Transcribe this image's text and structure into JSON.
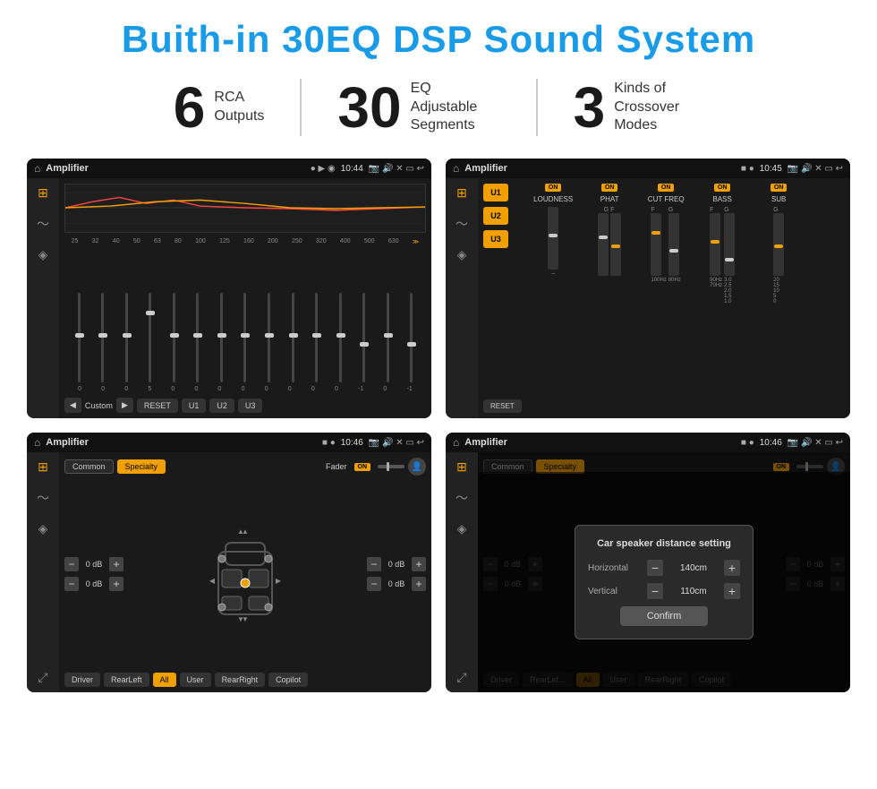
{
  "header": {
    "title": "Buith-in 30EQ DSP Sound System"
  },
  "stats": [
    {
      "number": "6",
      "label": "RCA\nOutputs"
    },
    {
      "number": "30",
      "label": "EQ Adjustable\nSegments"
    },
    {
      "number": "3",
      "label": "Kinds of\nCrossover Modes"
    }
  ],
  "screens": [
    {
      "id": "screen1",
      "app_title": "Amplifier",
      "time": "10:44",
      "eq_freqs": [
        "25",
        "32",
        "40",
        "50",
        "63",
        "80",
        "100",
        "125",
        "160",
        "200",
        "250",
        "320",
        "400",
        "500",
        "630"
      ],
      "eq_values": [
        "0",
        "0",
        "0",
        "5",
        "0",
        "0",
        "0",
        "0",
        "0",
        "0",
        "0",
        "0",
        "-1",
        "0",
        "-1"
      ],
      "toolbar": [
        "◀",
        "Custom",
        "▶",
        "RESET",
        "U1",
        "U2",
        "U3"
      ]
    },
    {
      "id": "screen2",
      "app_title": "Amplifier",
      "time": "10:45",
      "presets": [
        "U1",
        "U2",
        "U3"
      ],
      "sections": [
        "LOUDNESS",
        "PHAT",
        "CUT FREQ",
        "BASS",
        "SUB"
      ],
      "reset_label": "RESET"
    },
    {
      "id": "screen3",
      "app_title": "Amplifier",
      "time": "10:46",
      "tabs": [
        "Common",
        "Specialty"
      ],
      "fader": "Fader",
      "fader_on": "ON",
      "db_values": [
        "0 dB",
        "0 dB",
        "0 dB",
        "0 dB"
      ],
      "bottom_btns": [
        "Driver",
        "RearLeft",
        "All",
        "User",
        "RearRight",
        "Copilot"
      ]
    },
    {
      "id": "screen4",
      "app_title": "Amplifier",
      "time": "10:46",
      "tabs": [
        "Common",
        "Specialty"
      ],
      "dialog": {
        "title": "Car speaker distance setting",
        "horizontal_label": "Horizontal",
        "horizontal_value": "140cm",
        "vertical_label": "Vertical",
        "vertical_value": "110cm",
        "confirm_label": "Confirm",
        "db_right_1": "0 dB",
        "db_right_2": "0 dB"
      },
      "bottom_btns": [
        "Driver",
        "RearLef...",
        "All",
        "User",
        "RearRight",
        "Copilot"
      ]
    }
  ]
}
